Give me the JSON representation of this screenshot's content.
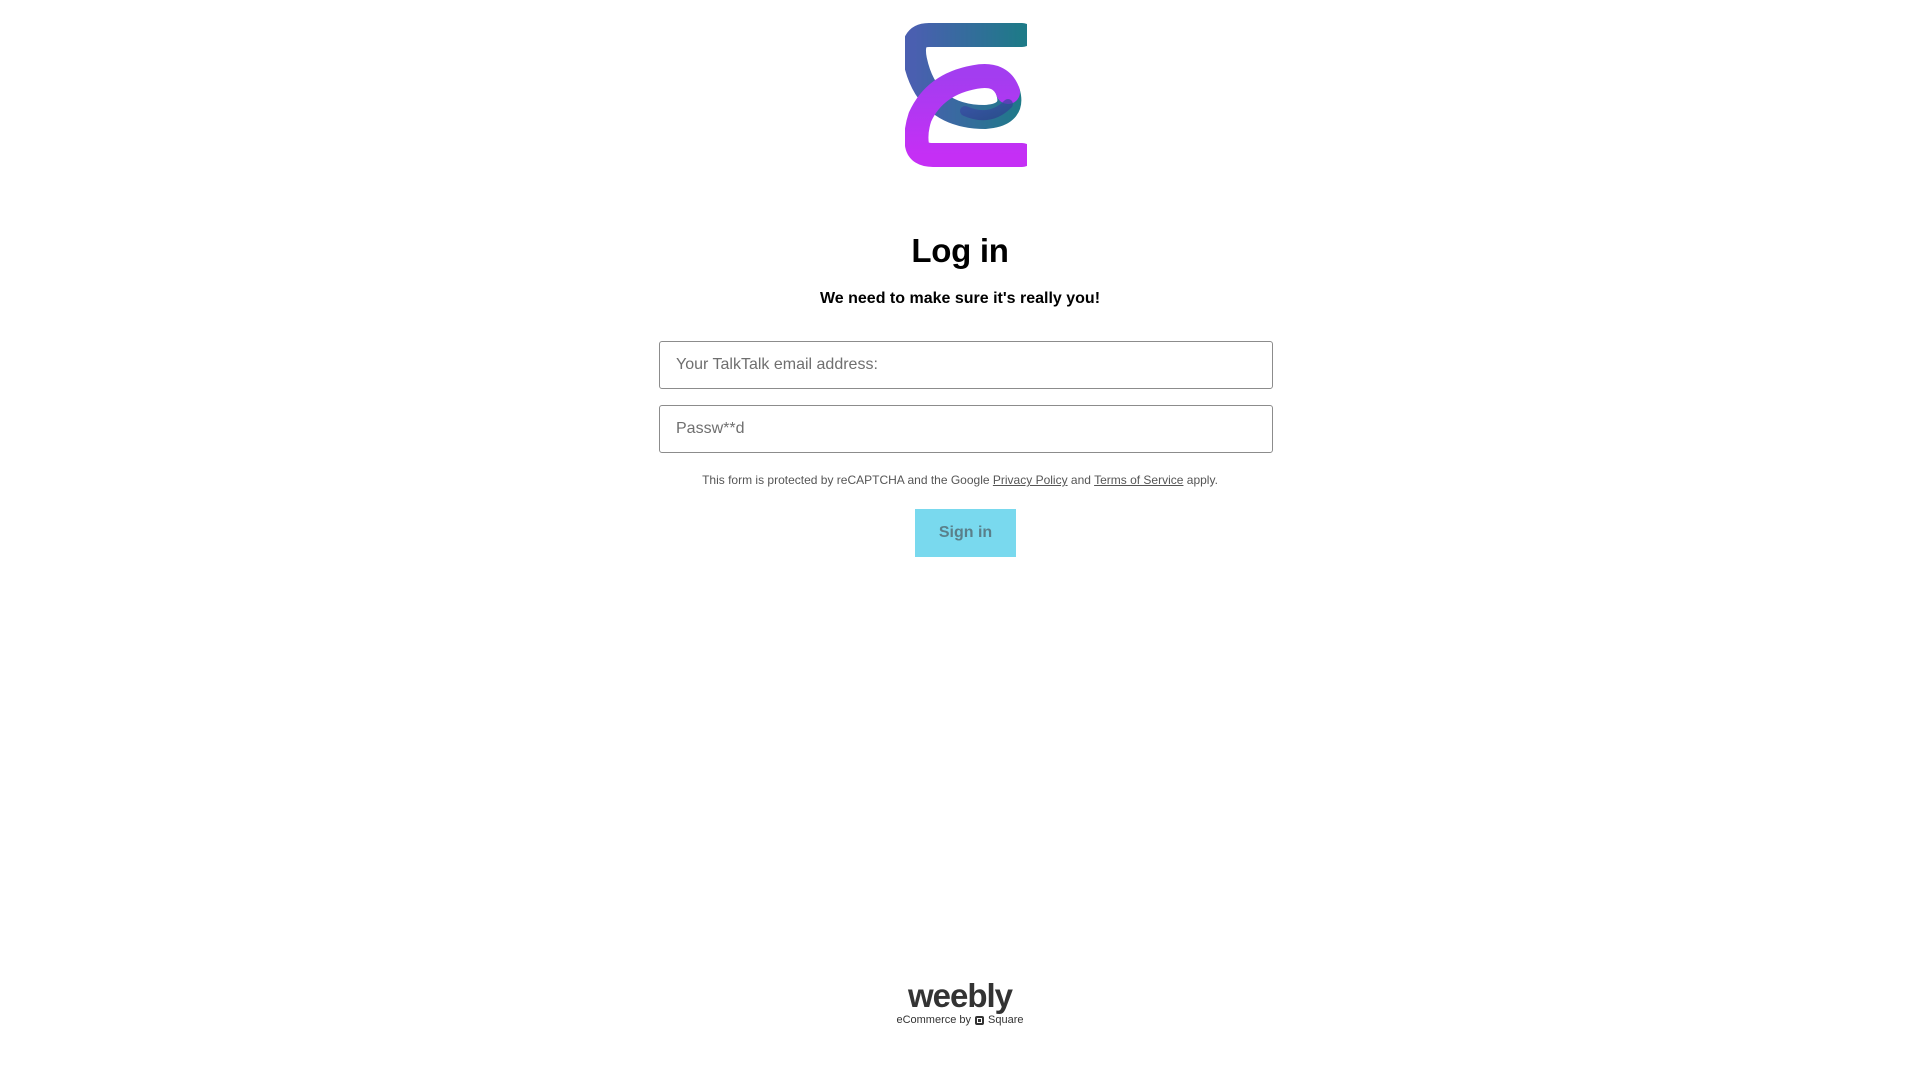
{
  "header": {
    "logo_icon": "gradient-letter-e-logo-icon"
  },
  "login": {
    "title": "Log in",
    "subtitle": "We need to make sure it's really you!",
    "email_placeholder": "Your TalkTalk email address:",
    "password_placeholder": "Passw**d",
    "notice_prefix": "This form is protected by reCAPTCHA and the Google",
    "privacy_link": "Privacy Policy",
    "notice_and": "and",
    "terms_link": "Terms of Service",
    "notice_suffix": "apply.",
    "signin_label": "Sign in"
  },
  "footer": {
    "brand": "weebly",
    "tagline_prefix": "eCommerce by",
    "tagline_company": "Square",
    "square_icon": "square-logo-icon"
  },
  "colors": {
    "button_bg": "#79d9ee",
    "logo_gradient_top": "#2a7a8c",
    "logo_gradient_bottom": "#c233f5"
  }
}
